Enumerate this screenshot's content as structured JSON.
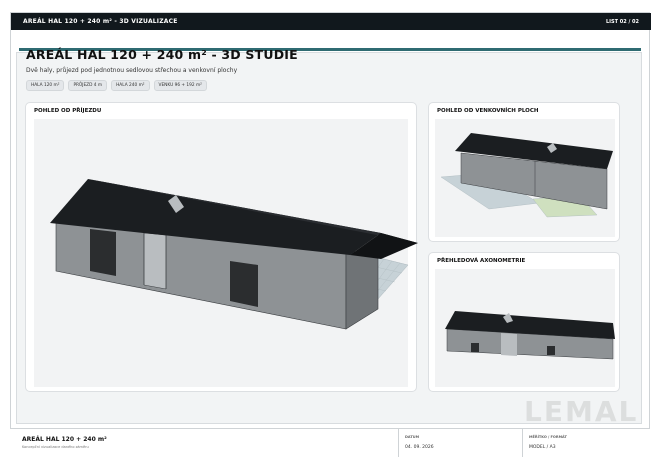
{
  "topbar": {
    "title": "AREÁL HAL 120 + 240 m² - 3D VIZUALIZACE",
    "sheet": "LIST 02 / 02"
  },
  "header": {
    "title": "AREÁL HAL 120 + 240 m² - 3D STUDIE",
    "subtitle": "Dvě haly, průjezd pod jednotnou sedlovou střechou a venkovní plochy",
    "badges": [
      "HALA 120 m²",
      "PRŮJEZD 4 m",
      "HALA 240 m²",
      "VENKU 96 + 192 m²"
    ]
  },
  "views": {
    "main": "POHLED OD PŘÍJEZDU",
    "outdoor": "POHLED OD VENKOVNÍCH PLOCH",
    "axonometry": "PŘEHLEDOVÁ AXONOMETRIE"
  },
  "footer": {
    "name": "AREÁL HAL 120 + 240 m²",
    "note": "Koncepční vizualizace daného záměru",
    "date_label": "DATUM",
    "date": "04. 09. 2026",
    "model_label": "MĚŘÍTKO / FORMÁT",
    "model": "MODEL / A3"
  },
  "watermark": "LEMAL",
  "colors": {
    "topbar": "#11181d",
    "accent": "#2f6b72",
    "roof": "#1b1e21",
    "wall": "#8c9093",
    "door": "#2b2d2f"
  }
}
